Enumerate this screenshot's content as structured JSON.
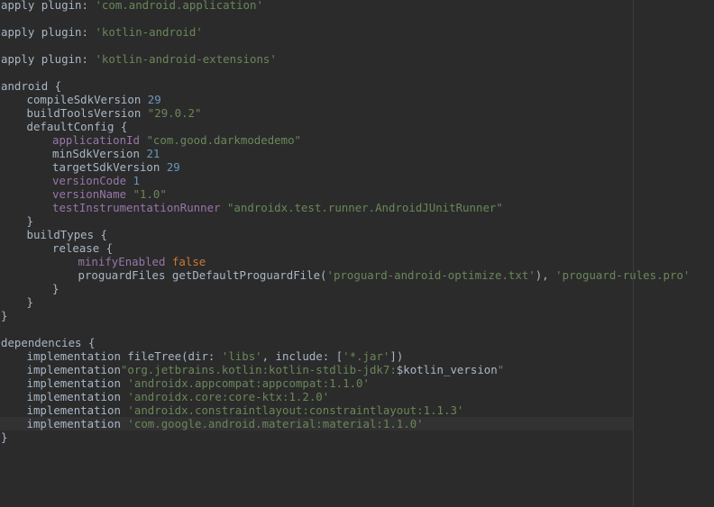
{
  "editor": {
    "language": "gradle",
    "theme_colors": {
      "background": "#2b2b2b",
      "default": "#a9b7c6",
      "string": "#6a8759",
      "number": "#6897bb",
      "property": "#9876aa",
      "keyword": "#cc7832"
    },
    "lines": [
      {
        "indent": 0,
        "tokens": [
          {
            "t": "apply plugin: ",
            "c": "plain"
          },
          {
            "t": "'com.android.application'",
            "c": "str"
          }
        ]
      },
      {
        "indent": 0,
        "tokens": []
      },
      {
        "indent": 0,
        "tokens": [
          {
            "t": "apply plugin: ",
            "c": "plain"
          },
          {
            "t": "'kotlin-android'",
            "c": "str"
          }
        ]
      },
      {
        "indent": 0,
        "tokens": []
      },
      {
        "indent": 0,
        "tokens": [
          {
            "t": "apply plugin: ",
            "c": "plain"
          },
          {
            "t": "'kotlin-android-extensions'",
            "c": "str"
          }
        ]
      },
      {
        "indent": 0,
        "tokens": []
      },
      {
        "indent": 0,
        "tokens": [
          {
            "t": "android {",
            "c": "plain"
          }
        ]
      },
      {
        "indent": 1,
        "tokens": [
          {
            "t": "compileSdkVersion ",
            "c": "plain"
          },
          {
            "t": "29",
            "c": "num"
          }
        ]
      },
      {
        "indent": 1,
        "tokens": [
          {
            "t": "buildToolsVersion ",
            "c": "plain"
          },
          {
            "t": "\"29.0.2\"",
            "c": "str"
          }
        ]
      },
      {
        "indent": 1,
        "tokens": [
          {
            "t": "defaultConfig {",
            "c": "plain"
          }
        ]
      },
      {
        "indent": 2,
        "tokens": [
          {
            "t": "applicationId ",
            "c": "prop"
          },
          {
            "t": "\"com.good.darkmodedemo\"",
            "c": "str"
          }
        ]
      },
      {
        "indent": 2,
        "tokens": [
          {
            "t": "minSdkVersion ",
            "c": "plain"
          },
          {
            "t": "21",
            "c": "num"
          }
        ]
      },
      {
        "indent": 2,
        "tokens": [
          {
            "t": "targetSdkVersion ",
            "c": "plain"
          },
          {
            "t": "29",
            "c": "num"
          }
        ]
      },
      {
        "indent": 2,
        "tokens": [
          {
            "t": "versionCode ",
            "c": "prop"
          },
          {
            "t": "1",
            "c": "num"
          }
        ]
      },
      {
        "indent": 2,
        "tokens": [
          {
            "t": "versionName ",
            "c": "prop"
          },
          {
            "t": "\"1.0\"",
            "c": "str"
          }
        ]
      },
      {
        "indent": 2,
        "tokens": [
          {
            "t": "testInstrumentationRunner ",
            "c": "prop"
          },
          {
            "t": "\"androidx.test.runner.AndroidJUnitRunner\"",
            "c": "str"
          }
        ]
      },
      {
        "indent": 1,
        "tokens": [
          {
            "t": "}",
            "c": "plain"
          }
        ]
      },
      {
        "indent": 1,
        "tokens": [
          {
            "t": "buildTypes {",
            "c": "plain"
          }
        ]
      },
      {
        "indent": 2,
        "tokens": [
          {
            "t": "release {",
            "c": "plain"
          }
        ]
      },
      {
        "indent": 3,
        "tokens": [
          {
            "t": "minifyEnabled ",
            "c": "prop"
          },
          {
            "t": "false",
            "c": "bool"
          }
        ]
      },
      {
        "indent": 3,
        "tokens": [
          {
            "t": "proguardFiles getDefaultProguardFile(",
            "c": "plain"
          },
          {
            "t": "'proguard-android-optimize.txt'",
            "c": "str"
          },
          {
            "t": "), ",
            "c": "plain"
          },
          {
            "t": "'proguard-rules.pro'",
            "c": "str"
          }
        ]
      },
      {
        "indent": 2,
        "tokens": [
          {
            "t": "}",
            "c": "plain"
          }
        ]
      },
      {
        "indent": 1,
        "tokens": [
          {
            "t": "}",
            "c": "plain"
          }
        ]
      },
      {
        "indent": 0,
        "tokens": [
          {
            "t": "}",
            "c": "plain"
          }
        ]
      },
      {
        "indent": 0,
        "tokens": []
      },
      {
        "indent": 0,
        "tokens": [
          {
            "t": "dependencies {",
            "c": "plain"
          }
        ]
      },
      {
        "indent": 1,
        "tokens": [
          {
            "t": "implementation fileTree(",
            "c": "plain"
          },
          {
            "t": "dir: ",
            "c": "plain"
          },
          {
            "t": "'libs'",
            "c": "str"
          },
          {
            "t": ", ",
            "c": "plain"
          },
          {
            "t": "include: ",
            "c": "plain"
          },
          {
            "t": "[",
            "c": "plain"
          },
          {
            "t": "'*.jar'",
            "c": "str"
          },
          {
            "t": "])",
            "c": "plain"
          }
        ]
      },
      {
        "indent": 1,
        "tokens": [
          {
            "t": "implementation",
            "c": "plain"
          },
          {
            "t": "\"org.jetbrains.kotlin:kotlin-stdlib-jdk7:",
            "c": "str"
          },
          {
            "t": "$kotlin_version",
            "c": "plain"
          },
          {
            "t": "\"",
            "c": "str"
          }
        ]
      },
      {
        "indent": 1,
        "tokens": [
          {
            "t": "implementation ",
            "c": "plain"
          },
          {
            "t": "'androidx.appcompat:appcompat:1.1.0'",
            "c": "str"
          }
        ]
      },
      {
        "indent": 1,
        "tokens": [
          {
            "t": "implementation ",
            "c": "plain"
          },
          {
            "t": "'androidx.core:core-ktx:1.2.0'",
            "c": "str"
          }
        ]
      },
      {
        "indent": 1,
        "tokens": [
          {
            "t": "implementation ",
            "c": "plain"
          },
          {
            "t": "'androidx.constraintlayout:constraintlayout:1.1.3'",
            "c": "str"
          }
        ]
      },
      {
        "indent": 1,
        "tokens": [
          {
            "t": "implementation ",
            "c": "plain"
          },
          {
            "t": "'com.google.android.material:material:1.1.0'",
            "c": "str"
          }
        ],
        "current": true
      },
      {
        "indent": 0,
        "tokens": [
          {
            "t": "}",
            "c": "plain"
          }
        ]
      }
    ]
  }
}
